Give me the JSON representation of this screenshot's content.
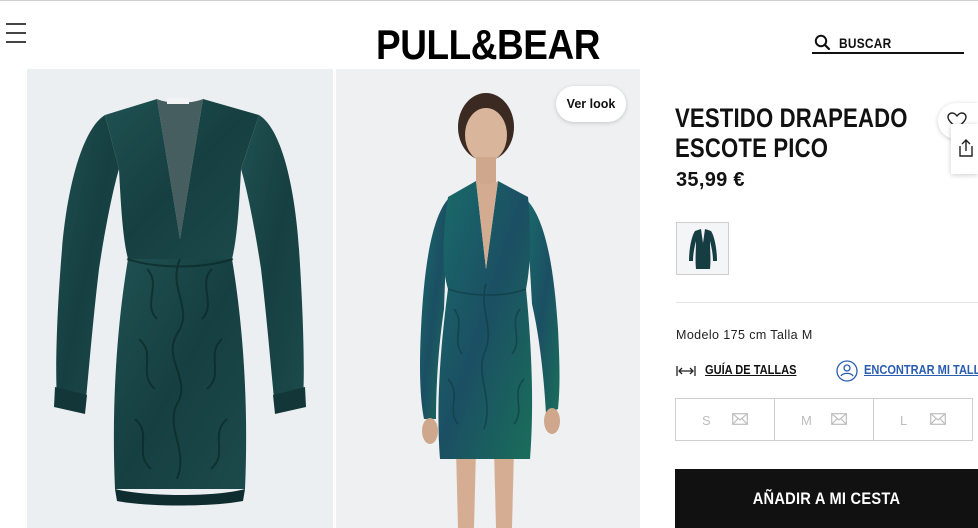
{
  "header": {
    "logo": "PULL&BEAR",
    "search_label": "BUSCAR"
  },
  "gallery": {
    "ver_look_label": "Ver look"
  },
  "product": {
    "title_line1": "VESTIDO DRAPEADO",
    "title_line2": "ESCOTE PICO",
    "price": "35,99 €",
    "model_info": "Modelo 175 cm Talla M",
    "size_guide_label": "GUÍA DE TALLAS",
    "find_size_label": "ENCONTRAR MI TALLA",
    "sizes": [
      {
        "label": "S"
      },
      {
        "label": "M"
      },
      {
        "label": "L"
      }
    ],
    "add_to_cart_label": "AÑADIR A MI CESTA"
  },
  "colors": {
    "dress_main": "#1d4a4c",
    "dress_dark": "#10302f",
    "add_to_cart_bg": "#111111",
    "link_blue": "#2a5db0"
  },
  "icons": {
    "menu": "hamburger-icon",
    "search": "search-icon",
    "favorite": "heart-icon",
    "share": "share-icon",
    "size_guide": "ruler-icon",
    "find_size": "person-icon",
    "notify": "envelope-icon"
  }
}
